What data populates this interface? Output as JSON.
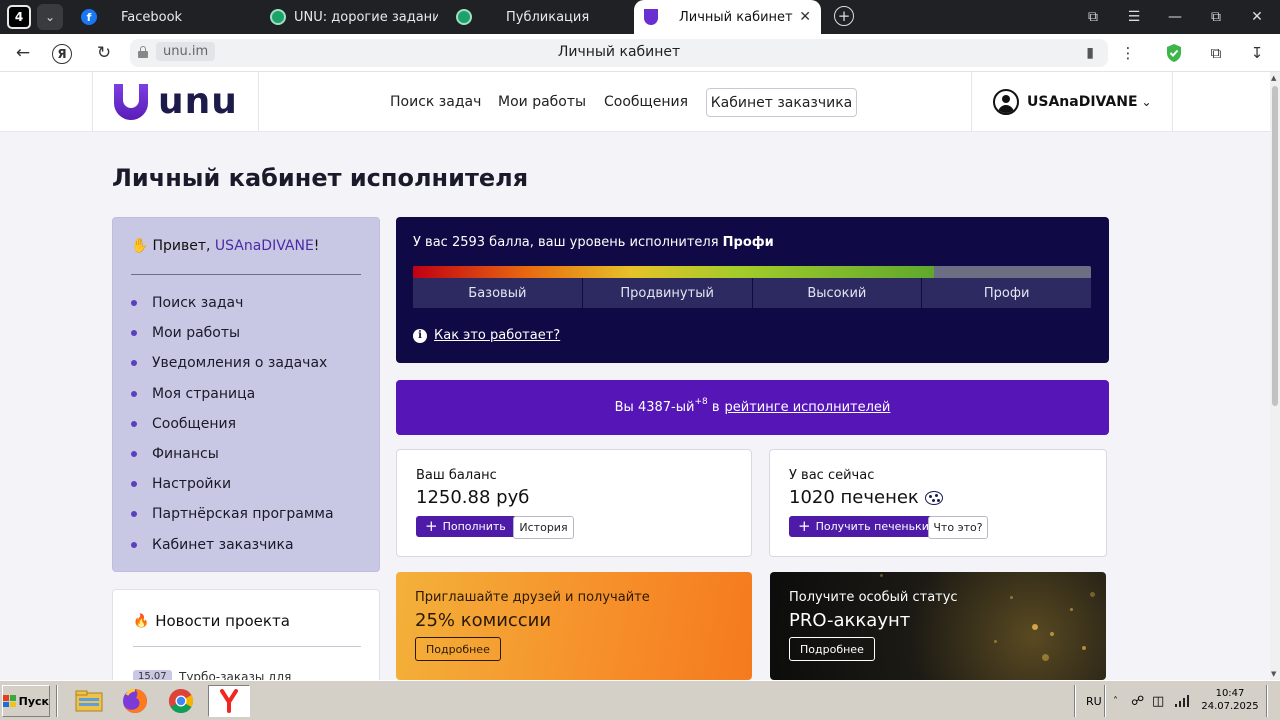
{
  "browser": {
    "tab_count": "4",
    "tabs": [
      {
        "title": "Facebook",
        "icon": "facebook-icon"
      },
      {
        "title": "UNU: дорогие задания дл",
        "icon": "unu-green-icon"
      },
      {
        "title": "Публикация",
        "icon": "unu-green-icon"
      },
      {
        "title": "Личный кабинет",
        "icon": "unu-logo-icon",
        "active": true
      }
    ],
    "url_host": "unu.im",
    "page_title": "Личный кабинет"
  },
  "header": {
    "logo_text": "unu",
    "nav": [
      "Поиск задач",
      "Мои работы",
      "Сообщения"
    ],
    "customer_button": "Кабинет заказчика",
    "username": "USAnaDIVANE"
  },
  "page": {
    "title": "Личный кабинет исполнителя"
  },
  "sidebar": {
    "greeting_prefix": "Привет,",
    "greeting_name": "USAnaDIVANE",
    "greeting_suffix": "!",
    "items": [
      "Поиск задач",
      "Мои работы",
      "Уведомления о задачах",
      "Моя страница",
      "Сообщения",
      "Финансы",
      "Настройки",
      "Партнёрская программа",
      "Кабинет заказчика"
    ]
  },
  "news": {
    "title": "Новости проекта",
    "date": "15.07",
    "text": "Турбо-заказы для"
  },
  "level": {
    "text_prefix": "У вас 2593 балла, ваш уровень исполнителя",
    "level_name": "Профи",
    "progress": 0.769,
    "grades": [
      "Базовый",
      "Продвинутый",
      "Высокий",
      "Профи"
    ],
    "how_link": "Как это работает?"
  },
  "rank": {
    "prefix": "Вы 4387-ый",
    "delta": "+8",
    "mid": "в",
    "link": "рейтинге исполнителей"
  },
  "balance": {
    "label": "Ваш баланс",
    "value": "1250.88 руб",
    "topup": "Пополнить",
    "history": "История"
  },
  "cookies": {
    "label": "У вас сейчас",
    "value": "1020 печенек",
    "get": "Получить печеньки",
    "what": "Что это?"
  },
  "promo_invite": {
    "sub": "Приглашайте друзей и получайте",
    "main": "25% комиссии",
    "button": "Подробнее"
  },
  "promo_pro": {
    "sub": "Получите особый статус",
    "main": "PRO-аккаунт",
    "button": "Подробнее"
  },
  "taskbar": {
    "start": "Пуск",
    "lang": "RU",
    "time": "10:47",
    "date": "24.07.2025"
  },
  "colors": {
    "accent": "#5515b7",
    "level_bg": "#0f0a45",
    "sidebar_bg": "#c9c8e4"
  }
}
